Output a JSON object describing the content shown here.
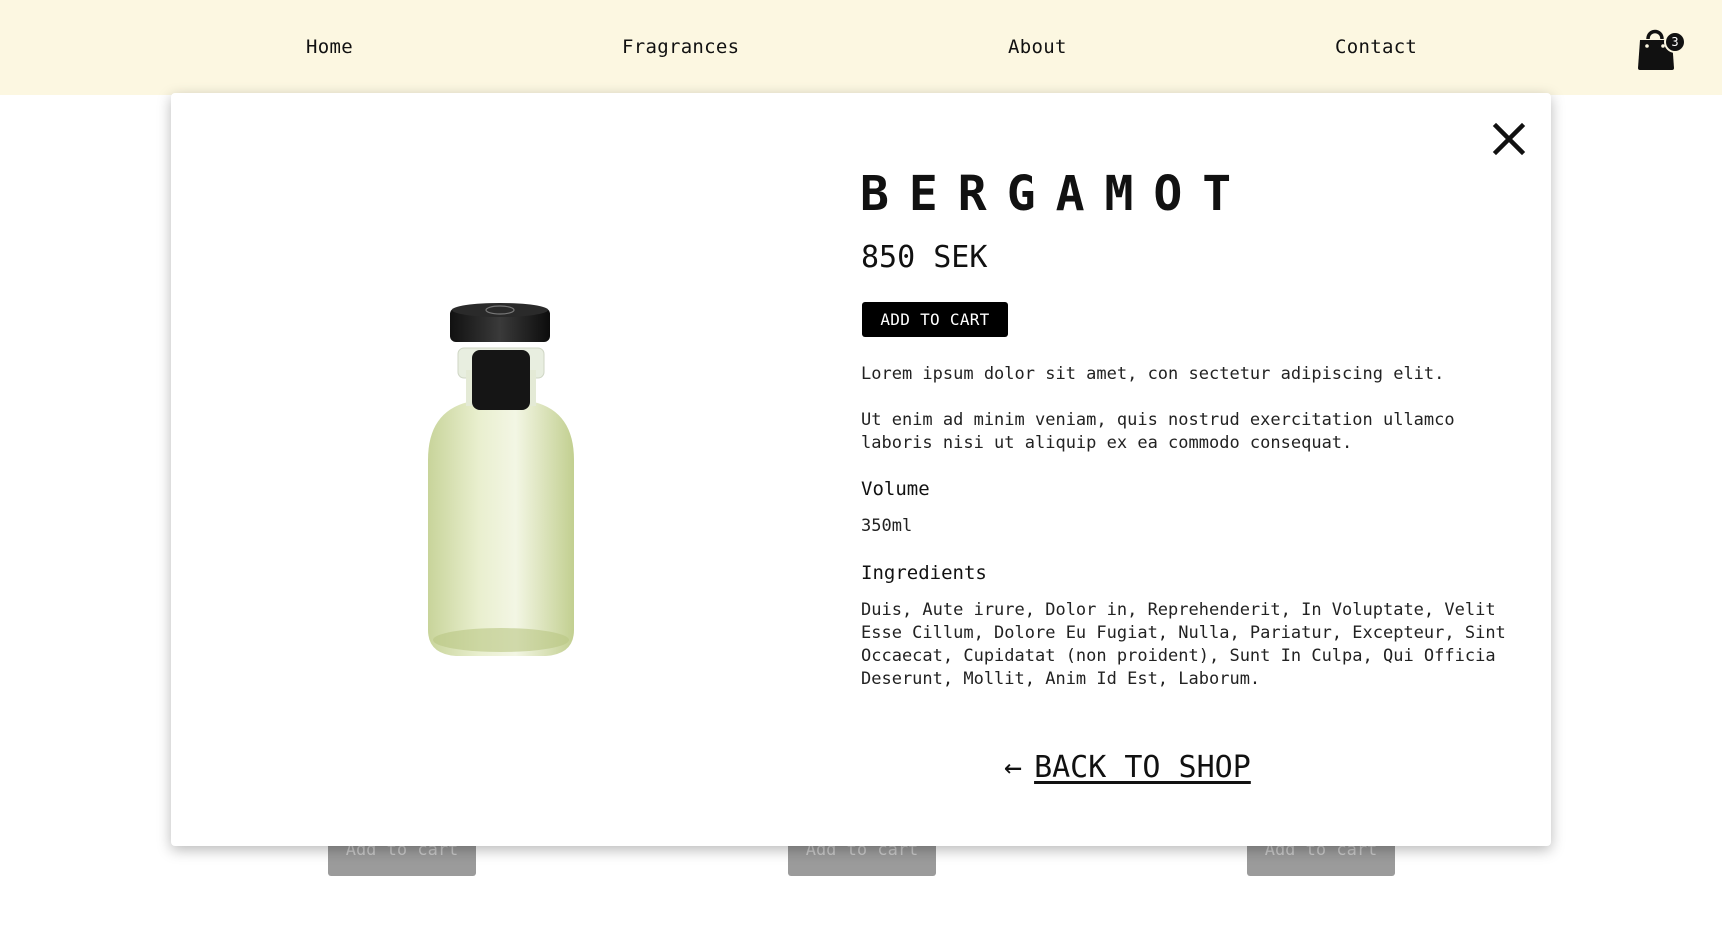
{
  "nav": {
    "items": [
      {
        "label": "Home"
      },
      {
        "label": "Fragrances"
      },
      {
        "label": "About"
      },
      {
        "label": "Contact"
      }
    ],
    "cart_count": "3",
    "cart_icon": "shopping-bag-icon"
  },
  "background": {
    "button_label": "Add to cart"
  },
  "modal": {
    "close_icon": "close-icon",
    "product": {
      "name": "BERGAMOT",
      "price": "850 SEK",
      "add_to_cart": "ADD TO CART",
      "description_1": "Lorem ipsum dolor sit amet, con sectetur adipiscing elit.",
      "description_2": "Ut enim ad minim veniam, quis nostrud exercitation ullamco laboris nisi ut aliquip ex ea commodo consequat.",
      "volume_label": "Volume",
      "volume_value": "350ml",
      "ingredients_label": "Ingredients",
      "ingredients_value": "Duis, Aute irure, Dolor in, Reprehenderit, In Voluptate, Velit Esse Cillum, Dolore Eu Fugiat, Nulla, Pariatur, Excepteur, Sint Occaecat, Cupidatat (non proident), Sunt In Culpa, Qui Officia Deserunt, Mollit, Anim Id Est, Laborum."
    },
    "back_arrow": "←",
    "back_label": "BACK TO SHOP"
  },
  "colors": {
    "header_bg": "#fcf7e1",
    "button_bg": "#000000",
    "bottle_liquid": "#d9e3b2"
  }
}
